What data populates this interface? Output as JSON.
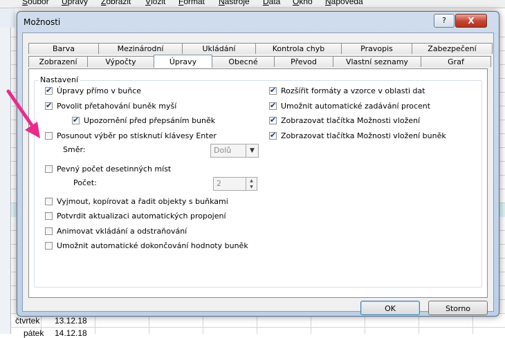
{
  "excel": {
    "menu": [
      "Soubor",
      "Úpravy",
      "Zobrazit",
      "Vložit",
      "Formát",
      "Nástroje",
      "Data",
      "Okno",
      "Nápověda"
    ],
    "cells": [
      "čtvrtek",
      "13.12.18",
      "pátek",
      "14.12.18"
    ]
  },
  "dialog": {
    "title": "Možnosti",
    "help_label": "?",
    "close_label": "X",
    "tabs_row1": [
      "Barva",
      "Mezinárodní",
      "Ukládání",
      "Kontrola chyb",
      "Pravopis",
      "Zabezpečení"
    ],
    "tabs_row2": [
      "Zobrazení",
      "Výpočty",
      "Úpravy",
      "Obecné",
      "Převod",
      "Vlastní seznamy",
      "Graf"
    ],
    "active_tab": "Úpravy",
    "group_label": "Nastavení",
    "options_left": [
      {
        "label": "Úpravy přímo v buňce",
        "checked": true
      },
      {
        "label": "Povolit přetahování buněk myší",
        "checked": true
      },
      {
        "label": "Upozornění před přepsáním buněk",
        "checked": true
      },
      {
        "label": "Posunout výběr po stisknutí klávesy Enter",
        "checked": false
      },
      {
        "label": "Pevný počet desetinných míst",
        "checked": false
      },
      {
        "label": "Vyjmout, kopírovat a řadit objekty s buňkami",
        "checked": false
      },
      {
        "label": "Potvrdit aktualizaci automatických propojení",
        "checked": false
      },
      {
        "label": "Animovat vkládání a odstraňování",
        "checked": false
      },
      {
        "label": "Umožnit automatické dokončování hodnoty buněk",
        "checked": false
      }
    ],
    "options_right": [
      {
        "label": "Rozšířit formáty a vzorce v oblasti dat",
        "checked": true
      },
      {
        "label": "Umožnit automatické zadávání procent",
        "checked": true
      },
      {
        "label": "Zobrazovat tlačítka Možnosti vložení",
        "checked": true
      },
      {
        "label": "Zobrazovat tlačítka Možnosti vložení buněk",
        "checked": true
      }
    ],
    "direction_label": "Směr:",
    "direction_value": "Dolů",
    "places_label": "Počet:",
    "places_value": "2",
    "ok_label": "OK",
    "cancel_label": "Storno"
  },
  "annotation_color": "#ec2a8c"
}
